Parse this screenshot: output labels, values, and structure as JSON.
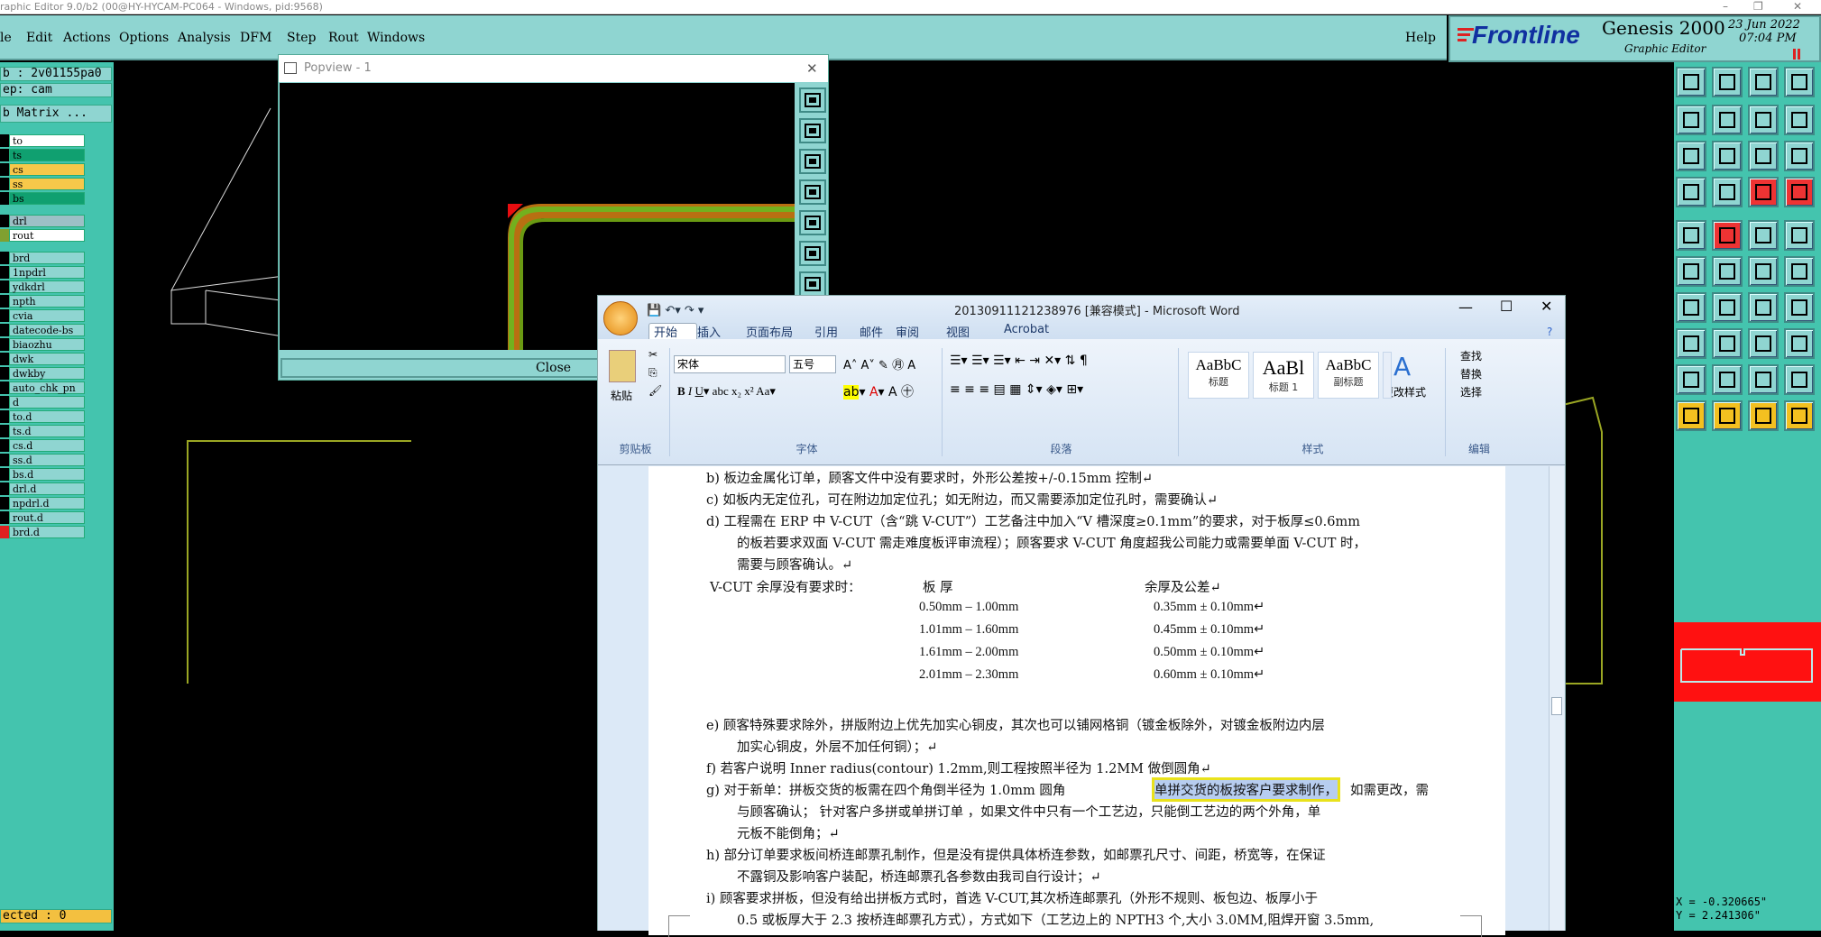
{
  "titlebar": "raphic Editor 9.0/b2 (00@HY-HYCAM-PC064 - Windows, pid:9568)",
  "menus": [
    "le",
    "Edit",
    "Actions",
    "Options",
    "Analysis",
    "DFM",
    "Step",
    "Rout",
    "Windows",
    "Help"
  ],
  "brand": {
    "logo": "Frontline",
    "product": "Genesis 2000",
    "subtitle": "Graphic Editor",
    "date": "23 Jun 2022",
    "time": "07:04 PM"
  },
  "left": {
    "job": "b : 2v01155pa0",
    "step": "ep: cam",
    "matrix": "b Matrix ...",
    "layers": [
      {
        "name": "to",
        "color": "#ffffff",
        "swatch": "#000000"
      },
      {
        "name": "ts",
        "color": "#10a070",
        "swatch": "#000000"
      },
      {
        "name": "cs",
        "color": "#f7c84a",
        "swatch": "#000000"
      },
      {
        "name": "ss",
        "color": "#f7c84a",
        "swatch": "#000000"
      },
      {
        "name": "bs",
        "color": "#10a070",
        "swatch": "#000000"
      },
      {
        "name": "drl",
        "color": "#9cc0c6",
        "swatch": "#000000"
      },
      {
        "name": "rout",
        "color": "#ffffff",
        "swatch": "#80a030"
      },
      {
        "name": "brd",
        "color": "#8fd5d1",
        "swatch": "#000000"
      },
      {
        "name": "1npdrl",
        "color": "#8fd5d1",
        "swatch": "#000000"
      },
      {
        "name": "ydkdrl",
        "color": "#8fd5d1",
        "swatch": "#000000"
      },
      {
        "name": "npth",
        "color": "#8fd5d1",
        "swatch": "#000000"
      },
      {
        "name": "cvia",
        "color": "#8fd5d1",
        "swatch": "#000000"
      },
      {
        "name": "datecode-bs",
        "color": "#8fd5d1",
        "swatch": "#000000"
      },
      {
        "name": "biaozhu",
        "color": "#8fd5d1",
        "swatch": "#000000"
      },
      {
        "name": "dwk",
        "color": "#8fd5d1",
        "swatch": "#000000"
      },
      {
        "name": "dwkby",
        "color": "#8fd5d1",
        "swatch": "#000000"
      },
      {
        "name": "auto_chk_pn",
        "color": "#8fd5d1",
        "swatch": "#000000"
      },
      {
        "name": "d",
        "color": "#8fd5d1",
        "swatch": "#000000"
      },
      {
        "name": "to.d",
        "color": "#8fd5d1",
        "swatch": "#000000"
      },
      {
        "name": "ts.d",
        "color": "#8fd5d1",
        "swatch": "#000000"
      },
      {
        "name": "cs.d",
        "color": "#8fd5d1",
        "swatch": "#000000"
      },
      {
        "name": "ss.d",
        "color": "#8fd5d1",
        "swatch": "#000000"
      },
      {
        "name": "bs.d",
        "color": "#8fd5d1",
        "swatch": "#000000"
      },
      {
        "name": "drl.d",
        "color": "#8fd5d1",
        "swatch": "#000000"
      },
      {
        "name": "npdrl.d",
        "color": "#8fd5d1",
        "swatch": "#000000"
      },
      {
        "name": "rout.d",
        "color": "#8fd5d1",
        "swatch": "#000000"
      },
      {
        "name": "brd.d",
        "color": "#8fd5d1",
        "swatch": "#e02020"
      }
    ],
    "selected": "ected : 0"
  },
  "popview": {
    "title": "Popview - 1",
    "close": "Close"
  },
  "coords": {
    "x": "X = -0.320665\"",
    "y": "Y = 2.241306\""
  },
  "word": {
    "title": "20130911121238976 [兼容模式] - Microsoft Word",
    "tabs": [
      "开始",
      "插入",
      "页面布局",
      "引用",
      "邮件",
      "审阅",
      "视图",
      "Acrobat"
    ],
    "font": "宋体",
    "size": "五号",
    "groups": [
      "剪贴板",
      "字体",
      "段落",
      "样式",
      "编辑"
    ],
    "paste": "粘贴",
    "styles": [
      {
        "preview": "AaBbC",
        "name": "标题"
      },
      {
        "preview": "AaBl",
        "name": "标题 1"
      },
      {
        "preview": "AaBbC",
        "name": "副标题"
      }
    ],
    "change_style": "更改样式",
    "edit": [
      "查找",
      "替换",
      "选择"
    ],
    "lines": [
      "b) 板边金属化订单，顾客文件中没有要求时，外形公差按+/-0.15mm 控制↵",
      "c) 如板内无定位孔，可在附边加定位孔；如无附边，而又需要添加定位孔时，需要确认↵",
      "d) 工程需在 ERP 中 V-CUT（含“跳 V-CUT”）工艺备注中加入“V 槽深度≥0.1mm”的要求，对于板厚≤0.6mm",
      "的板若要求双面 V-CUT 需走难度板评审流程）；顾客要求 V-CUT 角度超我公司能力或需要单面 V-CUT 时，",
      "需要与顾客确认。↵",
      "V-CUT 余厚没有要求时：",
      "板    厚",
      "余厚及公差↵",
      "e) 顾客特殊要求除外，拼版附边上优先加实心铜皮，其次也可以铺网格铜（镀金板除外，对镀金板附边内层",
      "加实心铜皮，外层不加任何铜）；↵",
      "f) 若客户说明 Inner radius(contour) 1.2mm,则工程按照半径为 1.2MM 做倒圆角↵",
      "g) 对于新单：拼板交货的板需在四个角倒半径为 1.0mm 圆角",
      "单拼交货的板按客户要求制作，",
      "如需更改，需",
      "与顾客确认；  针对客户多拼或单拼订单 ，如果文件中只有一个工艺边，只能倒工艺边的两个外角，单",
      "元板不能倒角；↵",
      "h) 部分订单要求板间桥连邮票孔制作，但是没有提供具体桥连参数，如邮票孔尺寸、间距，桥宽等，在保证",
      "不露铜及影响客户装配，桥连邮票孔各参数由我司自行设计；↵",
      "i) 顾客要求拼板，但没有给出拼板方式时，首选 V-CUT,其次桥连邮票孔（外形不规则、板包边、板厚小于",
      "0.5 或板厚大于 2.3 按桥连邮票孔方式），方式如下（工艺边上的 NPTH3 个,大小 3.0MM,阻焊开窗 3.5mm,"
    ],
    "table": [
      [
        "0.50mm – 1.00mm",
        "0.35mm ± 0.10mm↵"
      ],
      [
        "1.01mm – 1.60mm",
        "0.45mm ± 0.10mm↵"
      ],
      [
        "1.61mm – 2.00mm",
        "0.50mm ± 0.10mm↵"
      ],
      [
        "2.01mm – 2.30mm",
        "0.60mm ± 0.10mm↵"
      ]
    ]
  }
}
